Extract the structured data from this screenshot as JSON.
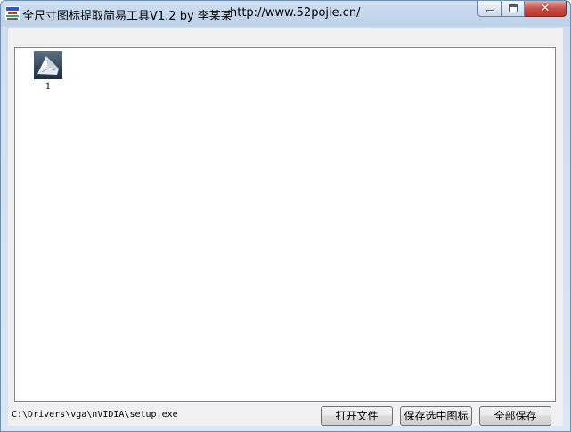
{
  "window": {
    "title": "全尺寸图标提取简易工具V1.2 by 李某某",
    "url": "http://www.52pojie.cn/",
    "caption_close": "✕"
  },
  "icons": {
    "app": "app-logo-icon",
    "thumbnail": "nvidia-setup-thumbnail-icon"
  },
  "list": {
    "items": [
      {
        "label": "1"
      }
    ]
  },
  "status": {
    "path": "C:\\Drivers\\vga\\nVIDIA\\setup.exe"
  },
  "buttons": {
    "open_file": "打开文件",
    "save_selected": "保存选中图标",
    "save_all": "全部保存"
  },
  "colors": {
    "close_button": "#c75050",
    "title_bar": "#bcd1e8",
    "list_border": "#828790"
  }
}
